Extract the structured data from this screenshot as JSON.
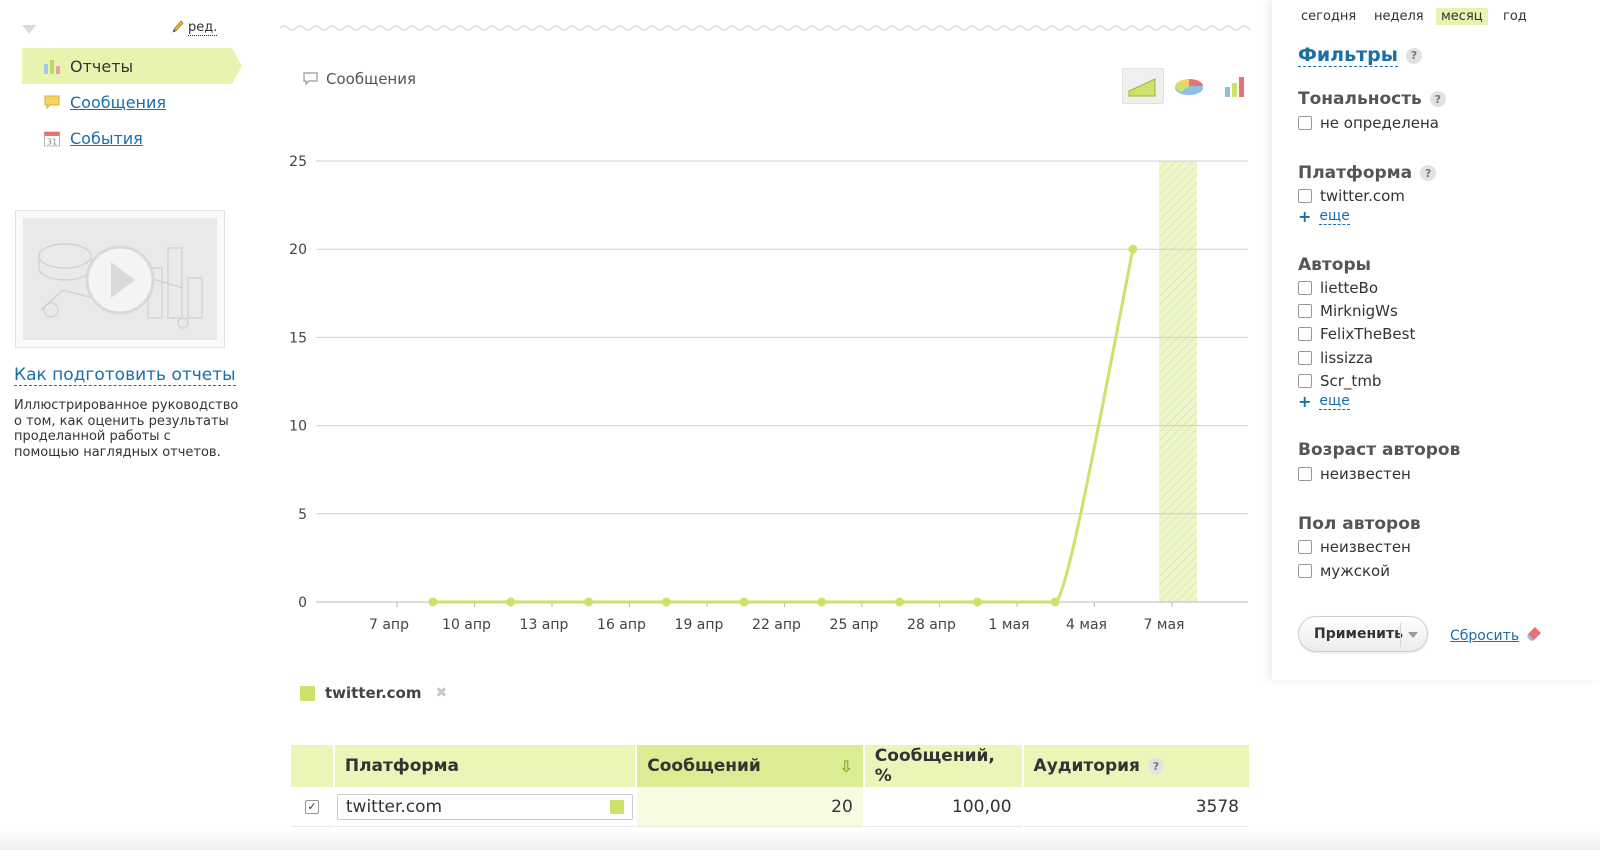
{
  "sidebar": {
    "edit_label": "ред.",
    "nav": [
      {
        "label": "Отчеты",
        "icon": "bar-chart-icon",
        "active": true
      },
      {
        "label": "Сообщения",
        "icon": "speech-bubble-icon",
        "active": false
      },
      {
        "label": "События",
        "icon": "calendar-icon",
        "active": false
      }
    ],
    "calendar_day": "31",
    "guide_title": "Как подготовить отчеты",
    "guide_desc": "Иллюстрированное руководство о том, как оценить результаты проделанной работы с помощью наглядных отчетов."
  },
  "main": {
    "chart_title": "Сообщения",
    "chart_types": [
      {
        "icon": "area-chart-icon",
        "active": true
      },
      {
        "icon": "pie-chart-icon",
        "active": false
      },
      {
        "icon": "bar-chart-icon",
        "active": false
      }
    ],
    "legend": {
      "label": "twitter.com",
      "color": "#cde26a",
      "remove_icon": "close-icon"
    },
    "table": {
      "headers": [
        "Платформа",
        "Сообщений",
        "Сообщений, %",
        "Аудитория"
      ],
      "sort_icon": "sort-down-icon",
      "rows": [
        {
          "checked": true,
          "check_glyph": "✓",
          "platform": "twitter.com",
          "messages": "20",
          "percent": "100,00",
          "audience": "3578"
        }
      ]
    }
  },
  "chart_data": {
    "type": "line",
    "x_ticks": [
      "7 апр",
      "10 апр",
      "13 апр",
      "16 апр",
      "19 апр",
      "22 апр",
      "25 апр",
      "28 апр",
      "1 мая",
      "4 мая",
      "7 мая"
    ],
    "y_ticks": [
      "0",
      "5",
      "10",
      "15",
      "20",
      "25"
    ],
    "ylim": [
      0,
      25
    ],
    "grid": true,
    "series": [
      {
        "name": "twitter.com",
        "color": "#cde26a",
        "x": [
          "2014-04-08",
          "2014-04-11",
          "2014-04-14",
          "2014-04-17",
          "2014-04-20",
          "2014-04-23",
          "2014-04-26",
          "2014-04-29",
          "2014-05-02",
          "2014-05-05"
        ],
        "values": [
          0,
          0,
          0,
          0,
          0,
          0,
          0,
          0,
          0,
          20
        ]
      }
    ],
    "highlight_range": [
      "2014-05-06",
      "2014-05-07"
    ]
  },
  "filters": {
    "periods": [
      {
        "label": "сегодня",
        "active": false
      },
      {
        "label": "неделя",
        "active": false
      },
      {
        "label": "месяц",
        "active": true
      },
      {
        "label": "год",
        "active": false
      }
    ],
    "title": "Фильтры",
    "help_glyph": "?",
    "groups": {
      "tone": {
        "title": "Тональность",
        "options": [
          "не определена"
        ]
      },
      "platform": {
        "title": "Платформа",
        "options": [
          "twitter.com"
        ],
        "more": "еще"
      },
      "authors": {
        "title": "Авторы",
        "options": [
          "lietteBo",
          "MirknigWs",
          "FelixTheBest",
          "lissizza",
          "Scr_tmb"
        ],
        "more": "еще"
      },
      "age": {
        "title": "Возраст авторов",
        "options": [
          "неизвестен"
        ]
      },
      "gender": {
        "title": "Пол авторов",
        "options": [
          "неизвестен",
          "мужской"
        ]
      }
    },
    "apply_label": "Применить",
    "reset_label": "Сбросить",
    "reset_icon": "eraser-icon",
    "more_glyph": "+"
  }
}
